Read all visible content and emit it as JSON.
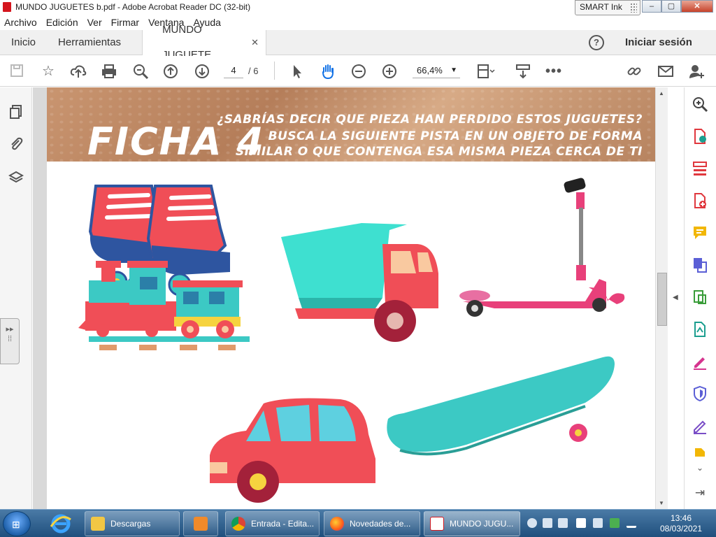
{
  "window": {
    "title": "MUNDO JUGUETES b.pdf - Adobe Acrobat Reader DC (32-bit)",
    "smart_ink": "SMART Ink",
    "controls": {
      "minimize": "–",
      "maximize": "▢",
      "close": "✕"
    }
  },
  "menu": [
    "Archivo",
    "Edición",
    "Ver",
    "Firmar",
    "Ventana",
    "Ayuda"
  ],
  "tabs": {
    "home": "Inicio",
    "tools": "Herramientas",
    "document": "MUNDO JUGUETE...",
    "close": "✕",
    "help": "?",
    "sign_in": "Iniciar sesión"
  },
  "toolbar": {
    "page_current": "4",
    "page_total": "/ 6",
    "zoom": "66,4%",
    "icons": [
      "save-icon",
      "star-icon",
      "upload-icon",
      "print-icon",
      "zoom-out-search-icon",
      "page-up-icon",
      "page-down-icon",
      "select-cursor-icon",
      "hand-icon",
      "zoom-out-icon",
      "zoom-in-icon",
      "fit-page-icon",
      "scroll-mode-icon",
      "more-icon",
      "share-link-icon",
      "mail-icon",
      "add-user-icon"
    ]
  },
  "document": {
    "heading": "FICHA 4",
    "instructions": [
      "¿SABRÍAS DECIR QUE PIEZA HAN PERDIDO ESTOS JUGUETES?",
      "BUSCA LA SIGUIENTE PISTA EN UN OBJETO DE FORMA",
      "SIMILAR O QUE CONTENGA ESA MISMA PIEZA CERCA DE TI"
    ],
    "illustrations": [
      "roller-skates",
      "dump-truck",
      "scooter",
      "toy-train",
      "car",
      "skateboard"
    ]
  },
  "colors": {
    "acrobat_red": "#d4161e",
    "toy_red": "#f04e57",
    "toy_teal": "#3cc9c4",
    "toy_pink": "#e8407a",
    "banner_brown": "#b98460"
  },
  "taskbar": {
    "buttons": [
      "",
      "",
      "Descargas",
      "",
      "Entrada - Edita...",
      "Novedades de...",
      "MUNDO JUGU..."
    ],
    "time": "13:46",
    "date": "08/03/2021"
  }
}
